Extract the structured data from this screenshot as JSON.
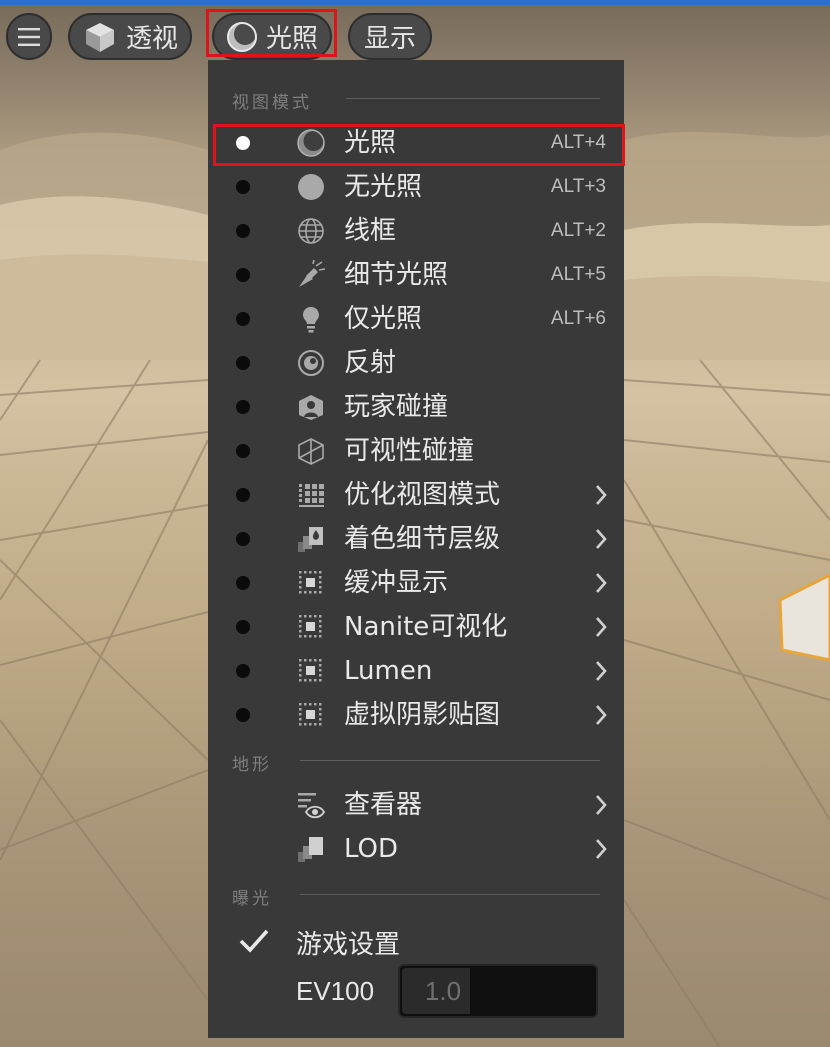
{
  "toolbar": {
    "menu_icon": "hamburger-icon",
    "perspective_label": "透视",
    "perspective_icon": "cube-icon",
    "lighting_label": "光照",
    "lighting_icon": "lit-sphere-icon",
    "show_label": "显示"
  },
  "menu": {
    "view_mode_header": "视图模式",
    "view_modes": [
      {
        "label": "光照",
        "shortcut": "ALT+4",
        "icon": "lit-sphere-icon",
        "active": true
      },
      {
        "label": "无光照",
        "shortcut": "ALT+3",
        "icon": "unlit-sphere-icon"
      },
      {
        "label": "线框",
        "shortcut": "ALT+2",
        "icon": "wireframe-globe-icon"
      },
      {
        "label": "细节光照",
        "shortcut": "ALT+5",
        "icon": "detail-lighting-icon"
      },
      {
        "label": "仅光照",
        "shortcut": "ALT+6",
        "icon": "light-bulb-icon"
      },
      {
        "label": "反射",
        "shortcut": "",
        "icon": "reflection-icon"
      },
      {
        "label": "玩家碰撞",
        "shortcut": "",
        "icon": "player-collision-icon"
      },
      {
        "label": "可视性碰撞",
        "shortcut": "",
        "icon": "visibility-collision-icon"
      },
      {
        "label": "优化视图模式",
        "shortcut": "",
        "icon": "optimization-grid-icon",
        "submenu": true
      },
      {
        "label": "着色细节层级",
        "shortcut": "",
        "icon": "shader-lod-icon",
        "submenu": true
      },
      {
        "label": "缓冲显示",
        "shortcut": "",
        "icon": "buffer-grid-icon",
        "submenu": true
      },
      {
        "label": "Nanite可视化",
        "shortcut": "",
        "icon": "buffer-grid-icon",
        "submenu": true
      },
      {
        "label": "Lumen",
        "shortcut": "",
        "icon": "buffer-grid-icon",
        "submenu": true
      },
      {
        "label": "虚拟阴影贴图",
        "shortcut": "",
        "icon": "buffer-grid-icon",
        "submenu": true
      }
    ],
    "landscape_header": "地形",
    "landscape_items": [
      {
        "label": "查看器",
        "icon": "visualizer-eye-icon",
        "submenu": true
      },
      {
        "label": "LOD",
        "icon": "lod-icon",
        "submenu": true
      }
    ],
    "exposure_header": "曝光",
    "game_settings_label": "游戏设置",
    "game_settings_checked": true,
    "ev100_label": "EV100",
    "ev100_value": "1.0"
  },
  "colors": {
    "menu_bg": "#393939",
    "toolbar_button_bg": "#494949",
    "highlight_red": "#e0131a",
    "active_dot": "#ffffff",
    "inactive_dot": "#0b0b0b",
    "selected_object_outline": "#e8a53a"
  }
}
